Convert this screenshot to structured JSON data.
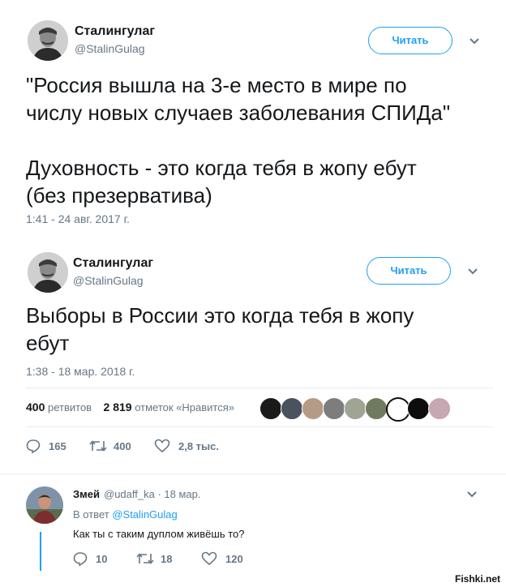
{
  "tweet1": {
    "name": "Сталингулаг",
    "handle": "@StalinGulag",
    "follow_label": "Читать",
    "text": "\"Россия вышла на 3-е место в мире по\nчислу новых случаев заболевания СПИДа\"\n\nДуховность - это когда тебя в жопу ебут\n(без презерватива)",
    "time": "1:41 - 24 авг. 2017 г."
  },
  "tweet2": {
    "name": "Сталингулаг",
    "handle": "@StalinGulag",
    "follow_label": "Читать",
    "text": "Выборы в России это когда тебя в жопу\nебут",
    "time": "1:38 - 18 мар. 2018 г.",
    "retweets_count": "400",
    "retweets_label": "ретвитов",
    "likes_count": "2 819",
    "likes_label": "отметок «Нравится»",
    "actions": {
      "replies": "165",
      "retweets": "400",
      "likes": "2,8 тыс."
    }
  },
  "reply": {
    "name": "Змей",
    "meta": "@udaff_ka · 18 мар.",
    "reply_prefix": "В ответ",
    "reply_to": "@StalinGulag",
    "text": "Как ты с таким дуплом живёшь то?",
    "actions": {
      "replies": "10",
      "retweets": "18",
      "likes": "120"
    }
  },
  "watermark": "Fishki.net",
  "colors": {
    "accent": "#1da1f2",
    "muted": "#657786",
    "text": "#14171a"
  }
}
